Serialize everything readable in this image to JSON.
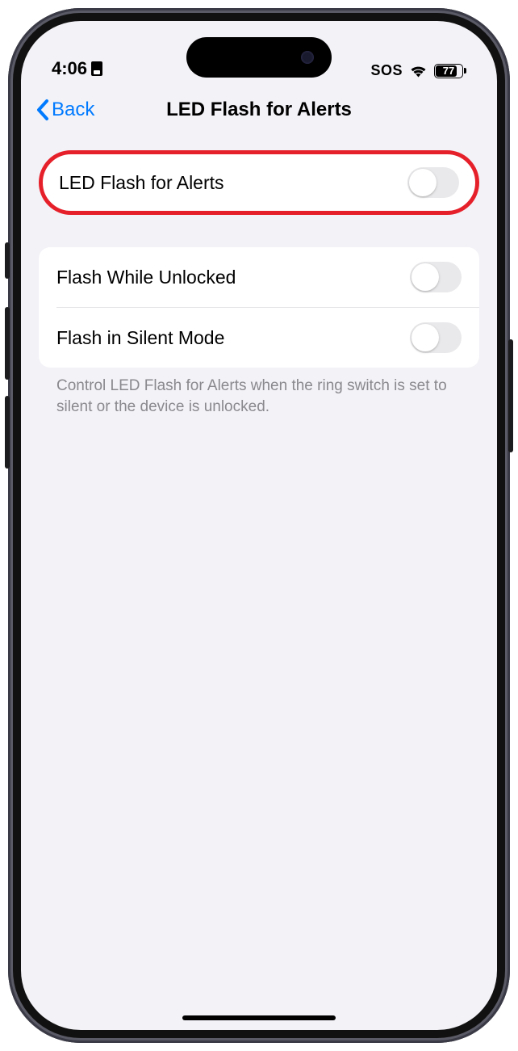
{
  "statusBar": {
    "time": "4:06",
    "sos": "SOS",
    "batteryPercent": "77"
  },
  "nav": {
    "backLabel": "Back",
    "title": "LED Flash for Alerts"
  },
  "settings": {
    "group1": {
      "items": [
        {
          "label": "LED Flash for Alerts"
        }
      ]
    },
    "group2": {
      "items": [
        {
          "label": "Flash While Unlocked"
        },
        {
          "label": "Flash in Silent Mode"
        }
      ],
      "footer": "Control LED Flash for Alerts when the ring switch is set to silent or the device is unlocked."
    }
  }
}
